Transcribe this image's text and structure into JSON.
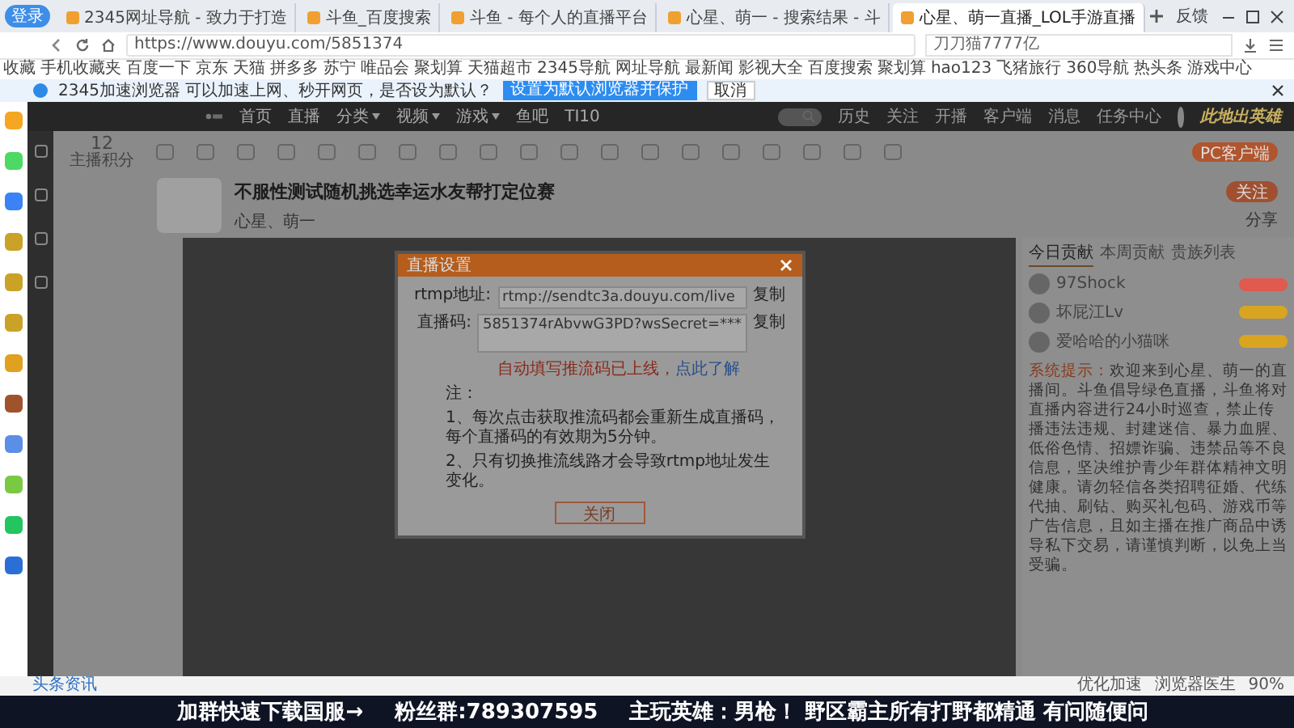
{
  "browser": {
    "profile_button": "登录",
    "tabs": [
      {
        "title": "2345网址导航 - 致力于打造",
        "selected": false
      },
      {
        "title": "斗鱼_百度搜索",
        "selected": false
      },
      {
        "title": "斗鱼 - 每个人的直播平台",
        "selected": false
      },
      {
        "title": "心星、萌一 - 搜索结果 - 斗",
        "selected": false
      },
      {
        "title": "心星、萌一直播_LOL手游直播",
        "selected": true
      }
    ],
    "feedback": "反馈",
    "url": "https://www.douyu.com/5851374",
    "search_value": "刀刀猫7777亿",
    "bookmarks": [
      "收藏",
      "手机收藏夹",
      "百度一下",
      "京东",
      "天猫",
      "拼多多",
      "苏宁",
      "唯品会",
      "聚划算",
      "天猫超市",
      "2345导航",
      "网址导航",
      "最新闻",
      "影视大全",
      "百度搜索",
      "聚划算",
      "hao123",
      "飞猪旅行",
      "360导航",
      "热头条",
      "游戏中心"
    ],
    "infobar": {
      "message": "2345加速浏览器 可以加速上网、秒开网页，是否设为默认？",
      "primary": "设置为默认浏览器并保护",
      "cancel": "取消"
    }
  },
  "site": {
    "nav": [
      {
        "label": "首页",
        "has_menu": false
      },
      {
        "label": "直播",
        "has_menu": false
      },
      {
        "label": "分类",
        "has_menu": true
      },
      {
        "label": "视频",
        "has_menu": true
      },
      {
        "label": "游戏",
        "has_menu": true
      },
      {
        "label": "鱼吧",
        "has_menu": false
      },
      {
        "label": "TI10",
        "has_menu": false
      }
    ],
    "user_links": [
      "历史",
      "关注",
      "开播",
      "客户端",
      "消息",
      "任务中心"
    ],
    "banner": "此地出英雄",
    "points": {
      "value": "12",
      "label": "主播积分"
    },
    "pc_client": "PC客户端",
    "stream": {
      "title": "不服性测试随机挑选幸运水友帮打定位赛",
      "anchor": "心星、萌一",
      "follow": "关注",
      "share": "分享"
    }
  },
  "modal": {
    "title": "直播设置",
    "rtmp_label": "rtmp地址:",
    "rtmp_value": "rtmp://sendtc3a.douyu.com/live",
    "code_label": "直播码:",
    "code_value": "5851374rAbvwG3PD?wsSecret=***",
    "rtmp_copy": "复制",
    "code_copy": "复制",
    "warning": "自动填写推流码已上线，",
    "learn_more": "点此了解",
    "notes_title": "注：",
    "notes": [
      "1、每次点击获取推流码都会重新生成直播码，每个直播码的有效期为5分钟。",
      "2、只有切换推流线路才会导致rtmp地址发生变化。"
    ],
    "close_button": "关闭"
  },
  "chat": {
    "tabs": [
      {
        "label": "今日贡献",
        "selected": true
      },
      {
        "label": "本周贡献",
        "selected": false
      },
      {
        "label": "贵族列表",
        "selected": false
      }
    ],
    "users": [
      {
        "name": "97Shock",
        "color": "#e05a50"
      },
      {
        "name": "坏屁江Lv",
        "color": "#d9a520"
      },
      {
        "name": "爱哈哈的小猫咪",
        "color": "#d9a520"
      }
    ],
    "system_label": "系统提示：",
    "system_text": "欢迎来到心星、萌一的直播间。斗鱼倡导绿色直播，斗鱼将对直播内容进行24小时巡查，禁止传播违法违规、封建迷信、暴力血腥、低俗色情、招嫖诈骗、违禁品等不良信息，坚决维护青少年群体精神文明健康。请勿轻信各类招聘征婚、代练代抽、刷钻、购买礼包码、游戏币等广告信息，且如主播在推广商品中诱导私下交易，请谨慎判断，以免上当受骗。"
  },
  "status_bar": {
    "news": "头条资讯",
    "items": [
      "优化加速",
      "浏览器医生"
    ],
    "zoom": "90%"
  },
  "overlay_band": [
    "加群快速下载国服→",
    "粉丝群:789307595",
    "主玩英雄：男枪！ 野区霸主所有打野都精通 有问随便问"
  ]
}
